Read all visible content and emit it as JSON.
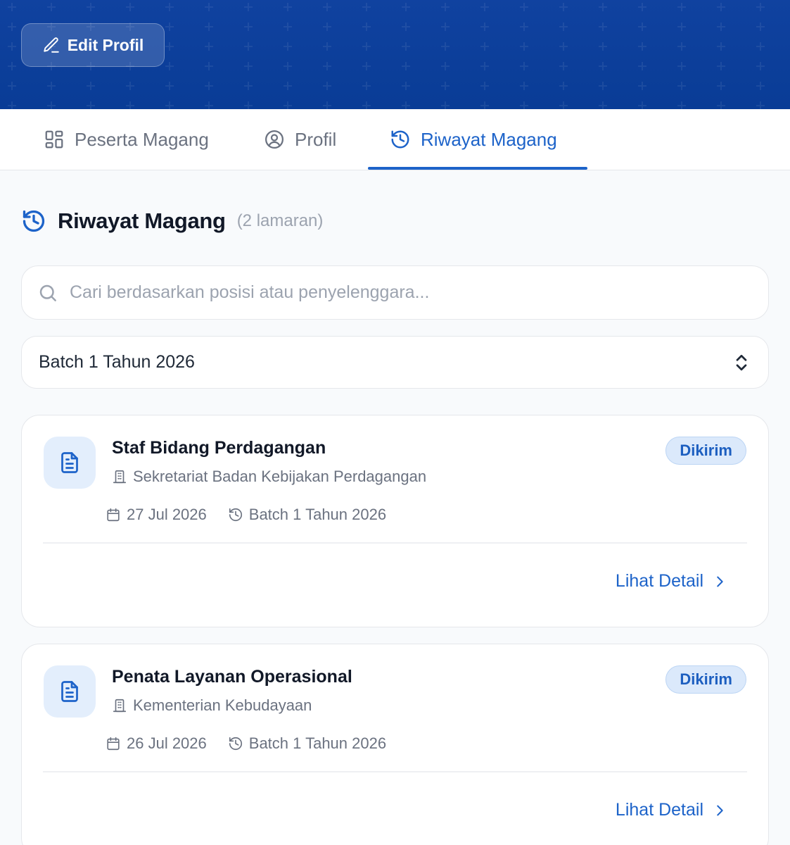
{
  "header": {
    "edit_profile_label": "Edit Profil",
    "banner_color": "#0b3f97"
  },
  "tabs": [
    {
      "label": "Peserta Magang",
      "icon": "grid-icon",
      "active": false
    },
    {
      "label": "Profil",
      "icon": "user-circle-icon",
      "active": false
    },
    {
      "label": "Riwayat Magang",
      "icon": "history-icon",
      "active": true
    }
  ],
  "section": {
    "title": "Riwayat Magang",
    "count_text": "(2 lamaran)",
    "icon": "history-icon"
  },
  "search": {
    "placeholder": "Cari berdasarkan posisi atau penyelenggara...",
    "value": ""
  },
  "filter": {
    "selected": "Batch 1 Tahun 2026"
  },
  "applications": [
    {
      "title": "Staf Bidang Perdagangan",
      "organization": "Sekretariat Badan Kebijakan Perdagangan",
      "status": "Dikirim",
      "date": "27 Jul 2026",
      "batch": "Batch 1 Tahun 2026",
      "action_label": "Lihat Detail"
    },
    {
      "title": "Penata Layanan Operasional",
      "organization": "Kementerian Kebudayaan",
      "status": "Dikirim",
      "date": "26 Jul 2026",
      "batch": "Batch 1 Tahun 2026",
      "action_label": "Lihat Detail"
    }
  ],
  "colors": {
    "accent": "#1d63c9",
    "badge_bg": "#dbe9fb",
    "text_muted": "#6b7280"
  }
}
